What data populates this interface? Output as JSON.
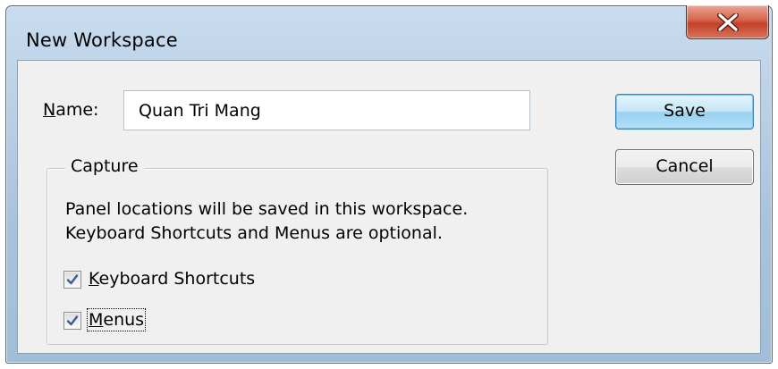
{
  "window": {
    "title": "New Workspace",
    "close_icon": "close-x-icon"
  },
  "form": {
    "name_label_mnemonic": "N",
    "name_label_rest": "ame:",
    "name_value": "Quan Tri Mang"
  },
  "buttons": {
    "save_label": "Save",
    "cancel_label": "Cancel"
  },
  "capture": {
    "legend": "Capture",
    "description_line1": "Panel locations will be saved in this workspace.",
    "description_line2": "Keyboard Shortcuts and Menus are optional.",
    "options": [
      {
        "mnemonic": "K",
        "rest": "eyboard Shortcuts",
        "checked": true
      },
      {
        "mnemonic": "M",
        "rest": "enus",
        "checked": true
      }
    ]
  },
  "colors": {
    "dialog_background": "#f0f0f0",
    "close_button_red": "#c4402a",
    "default_button_blue": "#98d1ef",
    "check_mark": "#3a5aa0"
  }
}
